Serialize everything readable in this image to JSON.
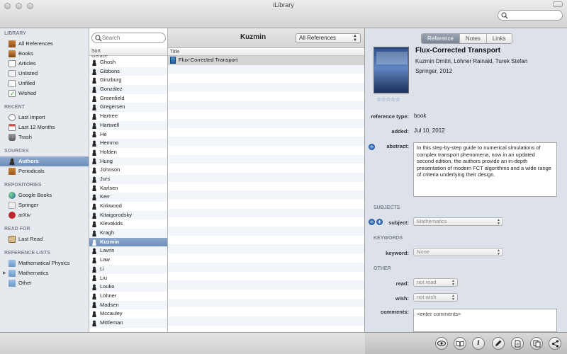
{
  "window": {
    "title": "iLibrary"
  },
  "top_search": {
    "placeholder": ""
  },
  "sidebar": {
    "sections": [
      {
        "title": "LIBRARY",
        "items": [
          {
            "label": "All References",
            "icon": "all-references-icon"
          },
          {
            "label": "Books",
            "icon": "books-icon"
          },
          {
            "label": "Articles",
            "icon": "articles-icon"
          },
          {
            "label": "Unlisted",
            "icon": "unlisted-icon"
          },
          {
            "label": "Unfiled",
            "icon": "unfiled-icon"
          },
          {
            "label": "Wished",
            "icon": "wished-icon"
          }
        ]
      },
      {
        "title": "RECENT",
        "items": [
          {
            "label": "Last Import",
            "icon": "clock-icon"
          },
          {
            "label": "Last 12 Months",
            "icon": "calendar-icon"
          },
          {
            "label": "Trash",
            "icon": "trash-icon"
          }
        ]
      },
      {
        "title": "SOURCES",
        "items": [
          {
            "label": "Authors",
            "icon": "authors-icon",
            "selected": true
          },
          {
            "label": "Periodicals",
            "icon": "periodicals-icon"
          }
        ]
      },
      {
        "title": "REPOSITORIES",
        "items": [
          {
            "label": "Google Books",
            "icon": "google-books-icon"
          },
          {
            "label": "Springer",
            "icon": "springer-icon"
          },
          {
            "label": "arXiv",
            "icon": "arxiv-icon"
          }
        ]
      },
      {
        "title": "READ FOR",
        "items": [
          {
            "label": "Last Read",
            "icon": "last-read-icon"
          }
        ]
      },
      {
        "title": "REFERENCE LISTS",
        "items": [
          {
            "label": "Mathematical Physics",
            "icon": "folder-icon"
          },
          {
            "label": "Mathematics",
            "icon": "folder-icon",
            "collapsed": true
          },
          {
            "label": "Other",
            "icon": "folder-icon"
          }
        ]
      }
    ]
  },
  "author_list": {
    "search_placeholder": "Search",
    "sort_label": "Sort",
    "partial_top": "Gerace",
    "authors": [
      "Ghosh",
      "Gibbons",
      "Ginzburg",
      "González",
      "Greenfield",
      "Gregersen",
      "Hartree",
      "Hartwell",
      "He",
      "Hemmo",
      "Holden",
      "Hung",
      "Johnson",
      "Jurs",
      "Karlsen",
      "Kerr",
      "Kirkwood",
      "Kitaigorodsky",
      "Klevakids",
      "Kragh",
      "Kuzmin",
      "Lavrin",
      "Law",
      "Li",
      "Liu",
      "Louko",
      "Löhner",
      "Madsen",
      "Mccauley",
      "Mittleman"
    ],
    "selected": "Kuzmin"
  },
  "middle": {
    "title": "Kuzmin",
    "filter": "All References",
    "column_title": "Title",
    "documents": [
      "Flux-Corrected Transport"
    ]
  },
  "detail": {
    "tabs": [
      "Reference",
      "Notes",
      "Links"
    ],
    "active_tab": "Reference",
    "title": "Flux-Corrected Transport",
    "authors": "Kuzmin Dmitri, Löhner Rainald, Turek Stefan",
    "publisher_year": "Springer, 2012",
    "rating": "☆☆☆☆☆",
    "rating_value": 0,
    "fields": {
      "reference_type_label": "reference type:",
      "reference_type": "book",
      "added_label": "added:",
      "added": "Jul 10, 2012",
      "abstract_label": "abstract:",
      "abstract": "In this step-by-step guide to numerical simulations of complex transport phenomena, now in an updated second edition, the authors provide an in-depth presentation of modern FCT algorithms and a wide range of criteria underlying their design."
    },
    "subjects_section": "SUBJECTS",
    "subject_label": "subject:",
    "subject": "Mathematics",
    "keywords_section": "KEYWORDS",
    "keyword_label": "keyword:",
    "keyword": "None",
    "other_section": "OTHER",
    "read_label": "read:",
    "read": "not read",
    "wish_label": "wish:",
    "wish": "not wish",
    "comments_label": "comments:",
    "comments_placeholder": "<enter comments>"
  },
  "toolbar": {
    "buttons": [
      "eye-icon",
      "book-open-icon",
      "info-icon",
      "pen-icon",
      "document-icon",
      "copy-icon",
      "share-icon"
    ]
  }
}
